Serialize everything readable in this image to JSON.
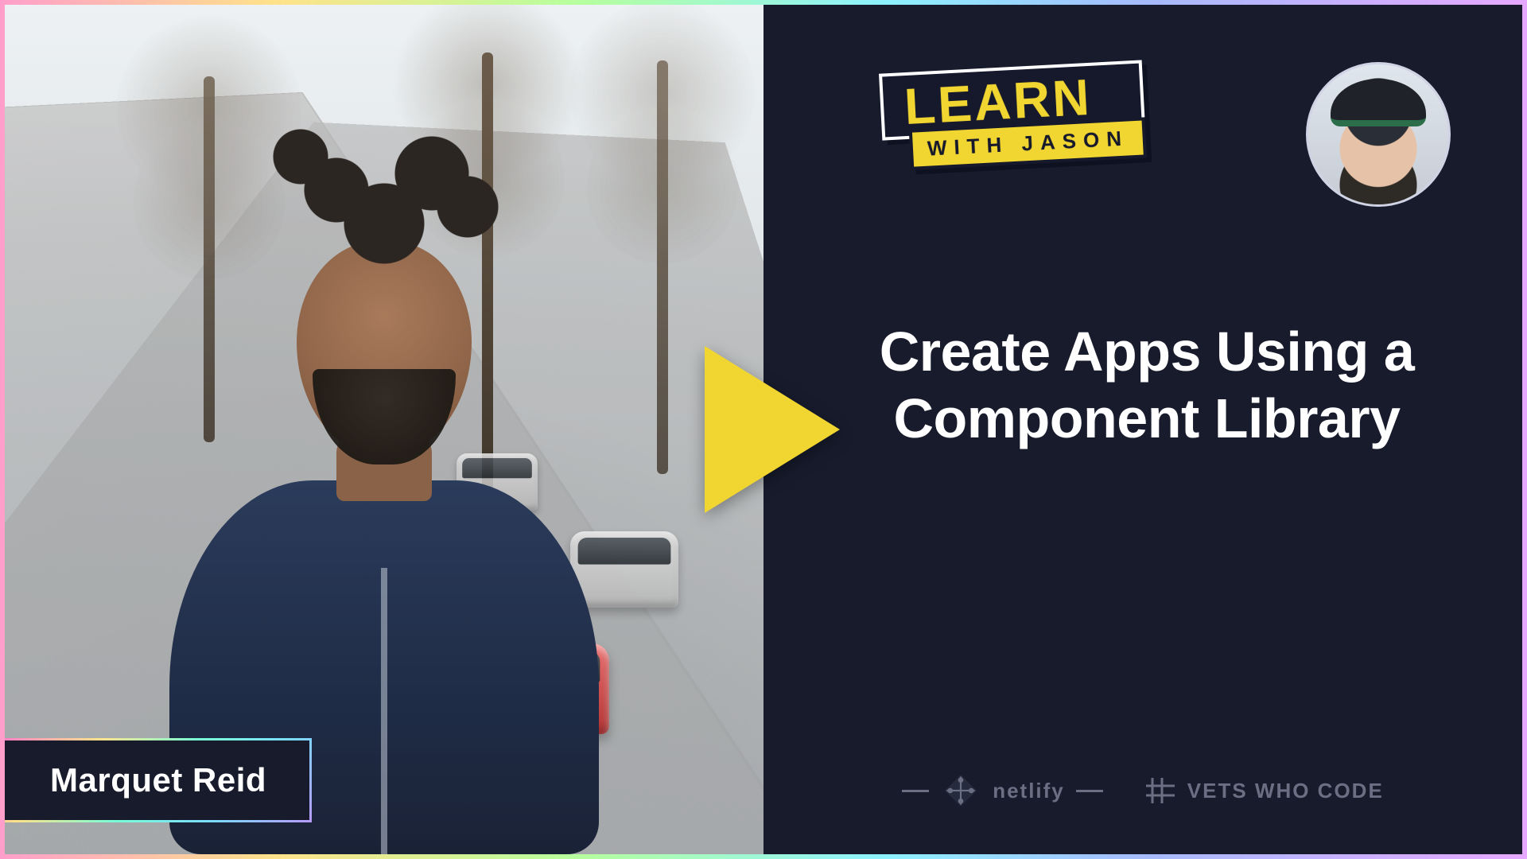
{
  "show": {
    "logo_top": "LEARN",
    "logo_bottom": "WITH JASON"
  },
  "guest": {
    "name": "Marquet Reid"
  },
  "episode": {
    "title": "Create Apps Using a Component Library"
  },
  "sponsors": {
    "netlify": "netlify",
    "vets": "VETS WHO CODE"
  },
  "colors": {
    "accent_yellow": "#f1d531",
    "panel_dark": "#171b2c"
  }
}
